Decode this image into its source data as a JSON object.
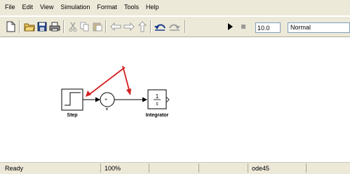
{
  "menu": [
    "File",
    "Edit",
    "View",
    "Simulation",
    "Format",
    "Tools",
    "Help"
  ],
  "toolbar": {
    "icons": [
      "new-file-icon",
      "open-folder-icon",
      "save-icon",
      "print-icon",
      "cut-icon",
      "copy-icon",
      "paste-icon",
      "back-arrow-icon",
      "forward-arrow-icon",
      "up-arrow-icon",
      "undo-icon",
      "redo-icon",
      "play-icon",
      "stop-icon"
    ],
    "stop_time": "10.0",
    "sim_mode": "Normal"
  },
  "model": {
    "step_label": "Step",
    "integrator_label": "Integrator",
    "integrator_numerator": "1",
    "integrator_denominator": "s",
    "sum_sign": "+",
    "sum_minus": "×",
    "annotation_color": "#d42020"
  },
  "status": {
    "state": "Ready",
    "zoom": "100%",
    "solver": "ode45"
  }
}
